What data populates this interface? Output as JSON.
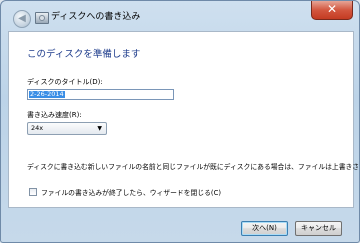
{
  "window": {
    "title": "ディスクへの書き込み",
    "close_label": "✕"
  },
  "main": {
    "heading": "このディスクを準備します",
    "disc_title_label": "ディスクのタイトル(D):",
    "disc_title_value": "2-26-2014",
    "speed_label": "書き込み速度(R):",
    "speed_value": "24x",
    "info_text": "ディスクに書き込む新しいファイルの名前と同じファイルが既にディスクにある場合は、ファイルは上書きされます。",
    "checkbox_label": "ファイルの書き込みが終了したら、ウィザードを閉じる(C)",
    "checkbox_checked": false
  },
  "footer": {
    "next_label": "次へ(N)",
    "cancel_label": "キャンセル"
  },
  "icons": {
    "back": "back-arrow-icon",
    "title": "disc-burn-icon",
    "chevron": "chevron-down-icon"
  }
}
